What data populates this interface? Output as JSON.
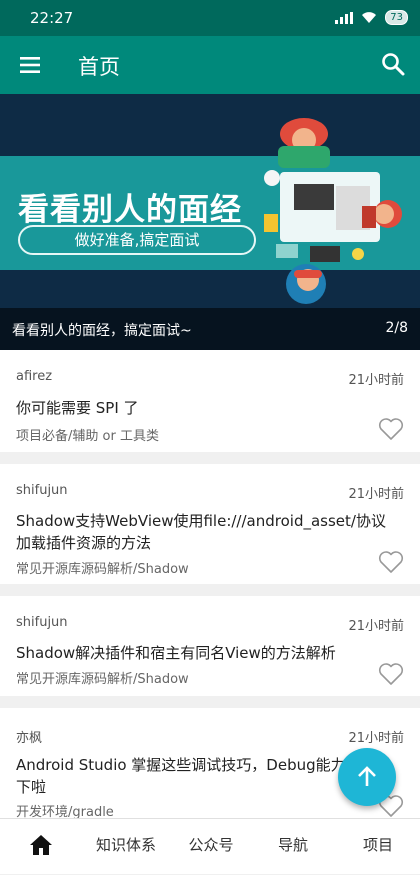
{
  "status_bar": {
    "time": "22:27",
    "battery": "73"
  },
  "toolbar": {
    "title": "首页"
  },
  "banner": {
    "headline": "看看别人的面经",
    "pill_text": "做好准备,搞定面试",
    "caption": "看看别人的面经，搞定面试~",
    "index": "2/8"
  },
  "articles": [
    {
      "author": "afirez",
      "time": "21小时前",
      "title": "你可能需要 SPI 了",
      "category": "项目必备/辅助 or 工具类"
    },
    {
      "author": "shifujun",
      "time": "21小时前",
      "title": "Shadow支持WebView使用file:///android_asset/协议加载插件资源的方法",
      "category": "常见开源库源码解析/Shadow"
    },
    {
      "author": "shifujun",
      "time": "21小时前",
      "title": "Shadow解决插件和宿主有同名View的方法解析",
      "category": "常见开源库源码解析/Shadow"
    },
    {
      "author": "亦枫",
      "time": "21小时前",
      "title": "Android Studio 掌握这些调试技巧，Debug能力不在话下啦",
      "category": "开发环境/gradle"
    }
  ],
  "bottom_nav": {
    "home": "home-icon",
    "knowledge": "知识体系",
    "wechat": "公众号",
    "navigation": "导航",
    "project": "项目"
  },
  "colors": {
    "toolbar": "#00897b",
    "status": "#00695c",
    "fab": "#1eb6d6",
    "banner_band": "#19989a"
  }
}
